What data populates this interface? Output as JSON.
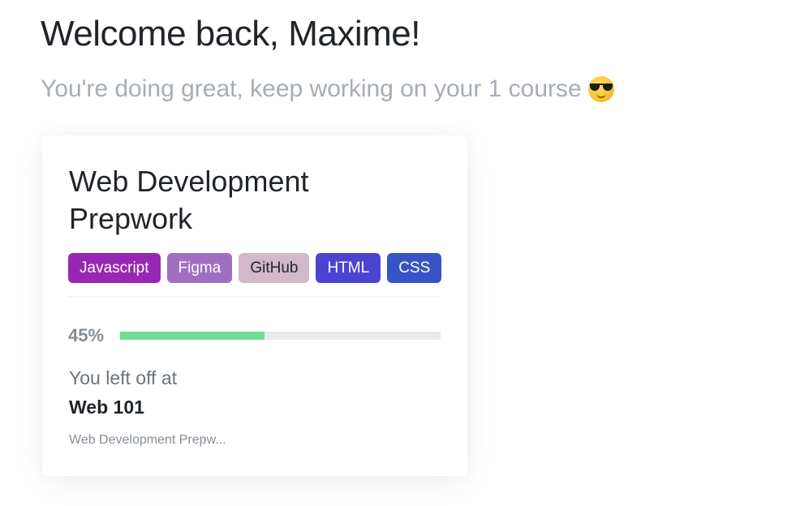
{
  "header": {
    "title": "Welcome back, Maxime!",
    "subtitle": "You're doing great, keep working on your 1 course",
    "subtitle_emoji": "smiling-face-with-sunglasses"
  },
  "course_card": {
    "title": "Web Development Prepwork",
    "tags": [
      {
        "label": "Javascript",
        "color": "#9727b3"
      },
      {
        "label": "Figma",
        "color": "#a06fc2"
      },
      {
        "label": "GitHub",
        "color": "#d3b8c9"
      },
      {
        "label": "HTML",
        "color": "#4d43d3"
      },
      {
        "label": "CSS",
        "color": "#3854c4"
      }
    ],
    "progress_label": "45%",
    "progress_value": 0.45,
    "progress_color": "#6fdc95",
    "left_off_label": "You left off at",
    "lesson": "Web 101",
    "course_subtitle": "Web Development Prepw..."
  }
}
